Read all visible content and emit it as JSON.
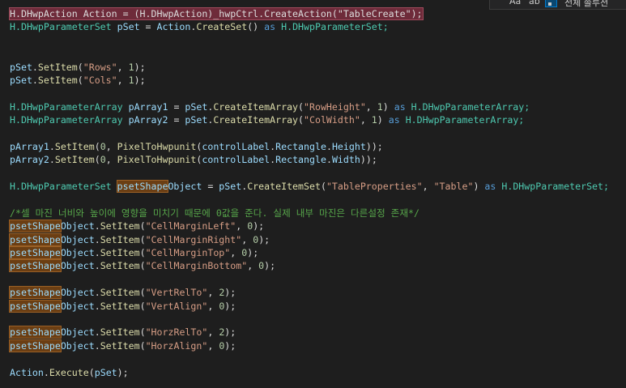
{
  "find_widget": {
    "match_case_label": "Aa",
    "whole_word_label": "ab",
    "scope_label": "전체 솔루션"
  },
  "colors": {
    "background": "#1e1e1e",
    "type": "#4ec9b0",
    "variable": "#9cdcfe",
    "method": "#dcdcaa",
    "string": "#d69d85",
    "number": "#b5cea8",
    "keyword": "#569cd6",
    "comment": "#57a64a",
    "highlight_red": "#6e2b3a",
    "highlight_brown": "#6b3e13"
  },
  "code": {
    "lines": [
      [
        {
          "text": "H.DHwpAction Action = (H.DHwpAction)_hwpCtrl.CreateAction(\"TableCreate\");",
          "cls": "t",
          "hl": "red"
        }
      ],
      [
        {
          "text": "H.DHwpParameterSet ",
          "cls": "ty"
        },
        {
          "text": "pSet",
          "cls": "v"
        },
        {
          "text": " = ",
          "cls": "t"
        },
        {
          "text": "Action",
          "cls": "v"
        },
        {
          "text": ".",
          "cls": "t"
        },
        {
          "text": "CreateSet",
          "cls": "m"
        },
        {
          "text": "() ",
          "cls": "t"
        },
        {
          "text": "as",
          "cls": "k"
        },
        {
          "text": " H.DHwpParameterSet;",
          "cls": "ty"
        }
      ],
      [],
      [],
      [
        {
          "text": "pSet",
          "cls": "v"
        },
        {
          "text": ".",
          "cls": "t"
        },
        {
          "text": "SetItem",
          "cls": "m"
        },
        {
          "text": "(",
          "cls": "t"
        },
        {
          "text": "\"Rows\"",
          "cls": "s"
        },
        {
          "text": ", ",
          "cls": "t"
        },
        {
          "text": "1",
          "cls": "n"
        },
        {
          "text": ");",
          "cls": "t"
        }
      ],
      [
        {
          "text": "pSet",
          "cls": "v"
        },
        {
          "text": ".",
          "cls": "t"
        },
        {
          "text": "SetItem",
          "cls": "m"
        },
        {
          "text": "(",
          "cls": "t"
        },
        {
          "text": "\"Cols\"",
          "cls": "s"
        },
        {
          "text": ", ",
          "cls": "t"
        },
        {
          "text": "1",
          "cls": "n"
        },
        {
          "text": ");",
          "cls": "t"
        }
      ],
      [],
      [
        {
          "text": "H.DHwpParameterArray ",
          "cls": "ty"
        },
        {
          "text": "pArray1",
          "cls": "v"
        },
        {
          "text": " = ",
          "cls": "t"
        },
        {
          "text": "pSet",
          "cls": "v"
        },
        {
          "text": ".",
          "cls": "t"
        },
        {
          "text": "CreateItemArray",
          "cls": "m"
        },
        {
          "text": "(",
          "cls": "t"
        },
        {
          "text": "\"RowHeight\"",
          "cls": "s"
        },
        {
          "text": ", ",
          "cls": "t"
        },
        {
          "text": "1",
          "cls": "n"
        },
        {
          "text": ") ",
          "cls": "t"
        },
        {
          "text": "as",
          "cls": "k"
        },
        {
          "text": " H.DHwpParameterArray;",
          "cls": "ty"
        }
      ],
      [
        {
          "text": "H.DHwpParameterArray ",
          "cls": "ty"
        },
        {
          "text": "pArray2",
          "cls": "v"
        },
        {
          "text": " = ",
          "cls": "t"
        },
        {
          "text": "pSet",
          "cls": "v"
        },
        {
          "text": ".",
          "cls": "t"
        },
        {
          "text": "CreateItemArray",
          "cls": "m"
        },
        {
          "text": "(",
          "cls": "t"
        },
        {
          "text": "\"ColWidth\"",
          "cls": "s"
        },
        {
          "text": ", ",
          "cls": "t"
        },
        {
          "text": "1",
          "cls": "n"
        },
        {
          "text": ") ",
          "cls": "t"
        },
        {
          "text": "as",
          "cls": "k"
        },
        {
          "text": " H.DHwpParameterArray;",
          "cls": "ty"
        }
      ],
      [],
      [
        {
          "text": "pArray1",
          "cls": "v"
        },
        {
          "text": ".",
          "cls": "t"
        },
        {
          "text": "SetItem",
          "cls": "m"
        },
        {
          "text": "(",
          "cls": "t"
        },
        {
          "text": "0",
          "cls": "n"
        },
        {
          "text": ", ",
          "cls": "t"
        },
        {
          "text": "PixelToHwpunit",
          "cls": "m"
        },
        {
          "text": "(",
          "cls": "t"
        },
        {
          "text": "controlLabel",
          "cls": "v"
        },
        {
          "text": ".",
          "cls": "t"
        },
        {
          "text": "Rectangle",
          "cls": "v"
        },
        {
          "text": ".",
          "cls": "t"
        },
        {
          "text": "Height",
          "cls": "v"
        },
        {
          "text": "));",
          "cls": "t"
        }
      ],
      [
        {
          "text": "pArray2",
          "cls": "v"
        },
        {
          "text": ".",
          "cls": "t"
        },
        {
          "text": "SetItem",
          "cls": "m"
        },
        {
          "text": "(",
          "cls": "t"
        },
        {
          "text": "0",
          "cls": "n"
        },
        {
          "text": ", ",
          "cls": "t"
        },
        {
          "text": "PixelToHwpunit",
          "cls": "m"
        },
        {
          "text": "(",
          "cls": "t"
        },
        {
          "text": "controlLabel",
          "cls": "v"
        },
        {
          "text": ".",
          "cls": "t"
        },
        {
          "text": "Rectangle",
          "cls": "v"
        },
        {
          "text": ".",
          "cls": "t"
        },
        {
          "text": "Width",
          "cls": "v"
        },
        {
          "text": "));",
          "cls": "t"
        }
      ],
      [],
      [
        {
          "text": "H.DHwpParameterSet ",
          "cls": "ty"
        },
        {
          "text": "psetShape",
          "cls": "v",
          "hl": "brown"
        },
        {
          "text": "Object",
          "cls": "v"
        },
        {
          "text": " = ",
          "cls": "t"
        },
        {
          "text": "pSet",
          "cls": "v"
        },
        {
          "text": ".",
          "cls": "t"
        },
        {
          "text": "CreateItemSet",
          "cls": "m"
        },
        {
          "text": "(",
          "cls": "t"
        },
        {
          "text": "\"TableProperties\"",
          "cls": "s"
        },
        {
          "text": ", ",
          "cls": "t"
        },
        {
          "text": "\"Table\"",
          "cls": "s"
        },
        {
          "text": ") ",
          "cls": "t"
        },
        {
          "text": "as",
          "cls": "k"
        },
        {
          "text": " H.DHwpParameterSet;",
          "cls": "ty"
        }
      ],
      [],
      [
        {
          "text": "/*셀 마진 너비와 높이에 영향을 미치기 때문에 0값을 준다. 실제 내부 마진은 다른설정 존재*/",
          "cls": "c"
        }
      ],
      [
        {
          "text": "psetShape",
          "cls": "v",
          "hl": "brown"
        },
        {
          "text": "Object",
          "cls": "v"
        },
        {
          "text": ".",
          "cls": "t"
        },
        {
          "text": "SetItem",
          "cls": "m"
        },
        {
          "text": "(",
          "cls": "t"
        },
        {
          "text": "\"CellMarginLeft\"",
          "cls": "s"
        },
        {
          "text": ", ",
          "cls": "t"
        },
        {
          "text": "0",
          "cls": "n"
        },
        {
          "text": ");",
          "cls": "t"
        }
      ],
      [
        {
          "text": "psetShape",
          "cls": "v",
          "hl": "brown"
        },
        {
          "text": "Object",
          "cls": "v"
        },
        {
          "text": ".",
          "cls": "t"
        },
        {
          "text": "SetItem",
          "cls": "m"
        },
        {
          "text": "(",
          "cls": "t"
        },
        {
          "text": "\"CellMarginRight\"",
          "cls": "s"
        },
        {
          "text": ", ",
          "cls": "t"
        },
        {
          "text": "0",
          "cls": "n"
        },
        {
          "text": ");",
          "cls": "t"
        }
      ],
      [
        {
          "text": "psetShape",
          "cls": "v",
          "hl": "brown"
        },
        {
          "text": "Object",
          "cls": "v"
        },
        {
          "text": ".",
          "cls": "t"
        },
        {
          "text": "SetItem",
          "cls": "m"
        },
        {
          "text": "(",
          "cls": "t"
        },
        {
          "text": "\"CellMarginTop\"",
          "cls": "s"
        },
        {
          "text": ", ",
          "cls": "t"
        },
        {
          "text": "0",
          "cls": "n"
        },
        {
          "text": ");",
          "cls": "t"
        }
      ],
      [
        {
          "text": "psetShape",
          "cls": "v",
          "hl": "brown"
        },
        {
          "text": "Object",
          "cls": "v"
        },
        {
          "text": ".",
          "cls": "t"
        },
        {
          "text": "SetItem",
          "cls": "m"
        },
        {
          "text": "(",
          "cls": "t"
        },
        {
          "text": "\"CellMarginBottom\"",
          "cls": "s"
        },
        {
          "text": ", ",
          "cls": "t"
        },
        {
          "text": "0",
          "cls": "n"
        },
        {
          "text": ");",
          "cls": "t"
        }
      ],
      [],
      [
        {
          "text": "psetShape",
          "cls": "v",
          "hl": "brown"
        },
        {
          "text": "Object",
          "cls": "v"
        },
        {
          "text": ".",
          "cls": "t"
        },
        {
          "text": "SetItem",
          "cls": "m"
        },
        {
          "text": "(",
          "cls": "t"
        },
        {
          "text": "\"VertRelTo\"",
          "cls": "s"
        },
        {
          "text": ", ",
          "cls": "t"
        },
        {
          "text": "2",
          "cls": "n"
        },
        {
          "text": ");",
          "cls": "t"
        }
      ],
      [
        {
          "text": "psetShape",
          "cls": "v",
          "hl": "brown"
        },
        {
          "text": "Object",
          "cls": "v"
        },
        {
          "text": ".",
          "cls": "t"
        },
        {
          "text": "SetItem",
          "cls": "m"
        },
        {
          "text": "(",
          "cls": "t"
        },
        {
          "text": "\"VertAlign\"",
          "cls": "s"
        },
        {
          "text": ", ",
          "cls": "t"
        },
        {
          "text": "0",
          "cls": "n"
        },
        {
          "text": ");",
          "cls": "t"
        }
      ],
      [],
      [
        {
          "text": "psetShape",
          "cls": "v",
          "hl": "brown"
        },
        {
          "text": "Object",
          "cls": "v"
        },
        {
          "text": ".",
          "cls": "t"
        },
        {
          "text": "SetItem",
          "cls": "m"
        },
        {
          "text": "(",
          "cls": "t"
        },
        {
          "text": "\"HorzRelTo\"",
          "cls": "s"
        },
        {
          "text": ", ",
          "cls": "t"
        },
        {
          "text": "2",
          "cls": "n"
        },
        {
          "text": ");",
          "cls": "t"
        }
      ],
      [
        {
          "text": "psetShape",
          "cls": "v",
          "hl": "brown"
        },
        {
          "text": "Object",
          "cls": "v"
        },
        {
          "text": ".",
          "cls": "t"
        },
        {
          "text": "SetItem",
          "cls": "m"
        },
        {
          "text": "(",
          "cls": "t"
        },
        {
          "text": "\"HorzAlign\"",
          "cls": "s"
        },
        {
          "text": ", ",
          "cls": "t"
        },
        {
          "text": "0",
          "cls": "n"
        },
        {
          "text": ");",
          "cls": "t"
        }
      ],
      [],
      [
        {
          "text": "Action",
          "cls": "v"
        },
        {
          "text": ".",
          "cls": "t"
        },
        {
          "text": "Execute",
          "cls": "m"
        },
        {
          "text": "(",
          "cls": "t"
        },
        {
          "text": "pSet",
          "cls": "v"
        },
        {
          "text": ");",
          "cls": "t"
        }
      ]
    ]
  }
}
